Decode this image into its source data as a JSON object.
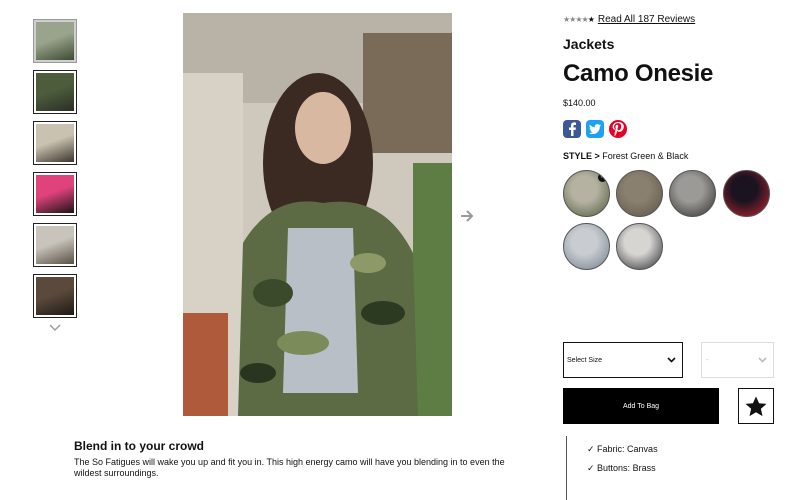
{
  "gallery": {
    "thumbnails": [
      {
        "name": "thumb-1",
        "colors": [
          "#9aa48c",
          "#3f4a32"
        ]
      },
      {
        "name": "thumb-2",
        "colors": [
          "#4d5d3c",
          "#2b2f24"
        ]
      },
      {
        "name": "thumb-3",
        "colors": [
          "#c9c2b0",
          "#3a352d"
        ]
      },
      {
        "name": "thumb-4",
        "colors": [
          "#e0427c",
          "#1c1416"
        ]
      },
      {
        "name": "thumb-5",
        "colors": [
          "#c8c4bb",
          "#5a5044"
        ]
      },
      {
        "name": "thumb-6",
        "colors": [
          "#5b4a3c",
          "#1f1a15"
        ]
      }
    ],
    "active_index": 0
  },
  "product": {
    "review_link": "Read All 187 Reviews",
    "rating_stars": 5,
    "rating_filled": 1,
    "category": "Jackets",
    "title": "Camo Onesie",
    "price": "$140.00",
    "style_label": "STYLE >",
    "style_value": "Forest Green & Black",
    "swatches": [
      {
        "name": "forest-green-black",
        "colors": [
          "#b6b2a1",
          "#4c5a3a"
        ],
        "selected": true
      },
      {
        "name": "swatch-2",
        "colors": [
          "#8a8070",
          "#5b5446"
        ],
        "selected": false
      },
      {
        "name": "swatch-3",
        "colors": [
          "#9c9a96",
          "#2f2e2c"
        ],
        "selected": false
      },
      {
        "name": "swatch-4",
        "colors": [
          "#1b1420",
          "#c8232f"
        ],
        "selected": false
      },
      {
        "name": "swatch-5",
        "colors": [
          "#c9ccd0",
          "#6f7d8c"
        ],
        "selected": false
      },
      {
        "name": "swatch-6",
        "colors": [
          "#d7d5d2",
          "#2a2a2e"
        ],
        "selected": false
      }
    ],
    "size_select": "Select Size",
    "qty_select": "-",
    "add_to_bag": "Add To Bag",
    "features": [
      "✓ Fabric: Canvas",
      "✓ Buttons: Brass"
    ]
  },
  "description": {
    "title": "Blend in to your crowd",
    "text": "The So Fatigues will wake you up and fit you in. This high energy camo will have you blending in to even the wildest surroundings."
  },
  "social": {
    "facebook_color": "#3b5998",
    "twitter_color": "#1da1f2",
    "pinterest_color": "#e60023"
  }
}
